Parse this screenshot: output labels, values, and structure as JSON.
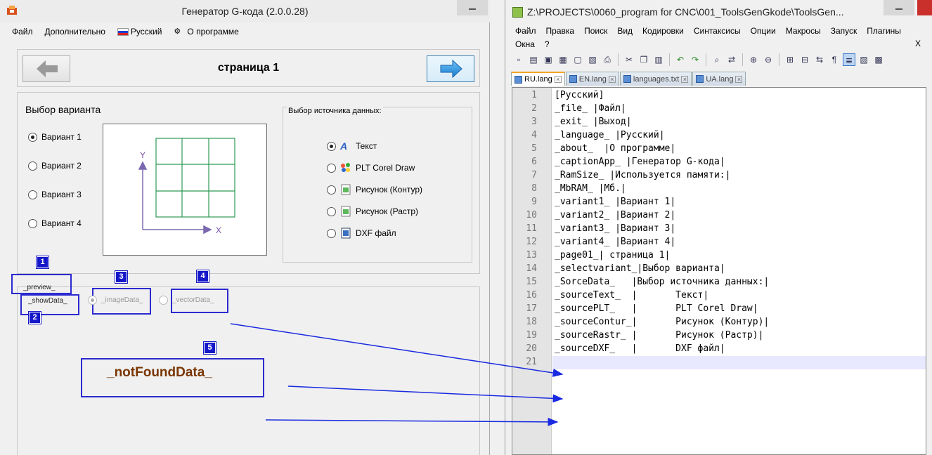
{
  "left_window": {
    "title": "Генератор G-кода (2.0.0.28)",
    "menu": [
      "Файл",
      "Дополнительно",
      "Русский",
      "О программе"
    ],
    "page_title": "страница 1",
    "variant_title": "Выбор варианта",
    "variants": [
      "Вариант 1",
      "Вариант 2",
      "Вариант 3",
      "Вариант 4"
    ],
    "selected_variant": 0,
    "preview_axes": {
      "y": "Y",
      "x": "X"
    },
    "source_group_title": "Выбор источника данных:",
    "sources": [
      "Текст",
      "PLT Corel Draw",
      "Рисунок (Контур)",
      "Рисунок (Растр)",
      "DXF файл"
    ],
    "selected_source": 0,
    "annotations": [
      {
        "num": "1",
        "text": "_preview_"
      },
      {
        "num": "2",
        "text": "_showData_"
      },
      {
        "num": "3",
        "text": "_imageData_"
      },
      {
        "num": "4",
        "text": "_vectorData_"
      },
      {
        "num": "5",
        "text": "_notFoundData_"
      }
    ],
    "accent_color": "#1518c8",
    "notfound_color": "#7a3500"
  },
  "right_window": {
    "title": "Z:\\PROJECTS\\0060_program for CNC\\001_ToolsGenGkode\\ToolsGen...",
    "menu_row1": [
      "Файл",
      "Правка",
      "Поиск",
      "Вид",
      "Кодировки",
      "Синтаксисы",
      "Опции",
      "Макросы",
      "Запуск",
      "Плагины"
    ],
    "menu_row2": [
      "Окна",
      "?"
    ],
    "menu_close": "X",
    "tabs": [
      "RU.lang",
      "EN.lang",
      "languages.txt",
      "UA.lang"
    ],
    "active_tab": 0,
    "lines": [
      "[Русский]",
      "_file_ |Файл|",
      "_exit_ |Выход|",
      "_language_ |Русский|",
      "_about_  |О программе|",
      "_captionApp_ |Генератор G-кода|",
      "_RamSize_ |Используется памяти:|",
      "_MbRAM_ |Мб.|",
      "_variant1_ |Вариант 1|",
      "_variant2_ |Вариант 2|",
      "_variant3_ |Вариант 3|",
      "_variant4_ |Вариант 4|",
      "_page01_| страница 1|",
      "_selectvariant_|Выбор варианта|",
      "_SorceData_   |Выбор источника данных:|",
      "_sourceText_  |       Текст|",
      "_sourcePLT_   |       PLT Corel Draw|",
      "_sourceContur_|       Рисунок (Контур)|",
      "_sourceRastr_ |       Рисунок (Растр)|",
      "_sourceDXF_   |       DXF файл|",
      ""
    ],
    "line_numbers": [
      "1",
      "2",
      "3",
      "4",
      "5",
      "6",
      "7",
      "8",
      "9",
      "10",
      "11",
      "12",
      "13",
      "14",
      "15",
      "16",
      "17",
      "18",
      "19",
      "20",
      "21"
    ],
    "current_line": 21
  }
}
